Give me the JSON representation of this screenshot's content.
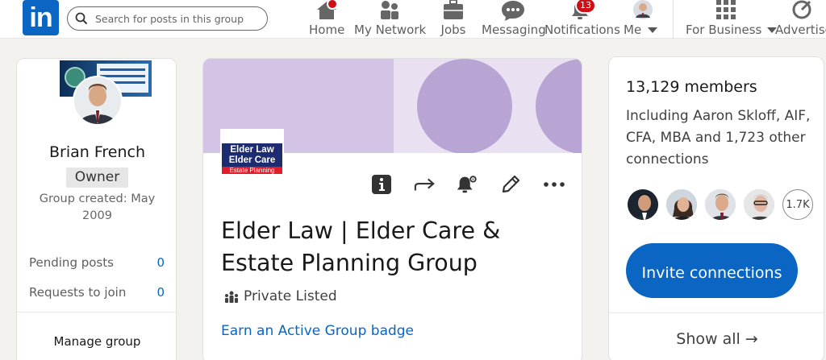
{
  "nav": {
    "logo_text": "in",
    "search_placeholder": "Search for posts in this group",
    "items": [
      {
        "label": "Home"
      },
      {
        "label": "My Network"
      },
      {
        "label": "Jobs"
      },
      {
        "label": "Messaging"
      },
      {
        "label": "Notifications",
        "badge": "13"
      },
      {
        "label": "Me"
      },
      {
        "label": "For Business"
      },
      {
        "label": "Advertise"
      }
    ]
  },
  "left": {
    "owner_name": "Brian French",
    "owner_role": "Owner",
    "created": "Group created: May 2009",
    "stats": [
      {
        "label": "Pending posts",
        "value": "0"
      },
      {
        "label": "Requests to join",
        "value": "0"
      }
    ],
    "manage_label": "Manage group"
  },
  "center": {
    "logo_line1": "Elder Law",
    "logo_line2": "Elder Care",
    "logo_line3": "Estate Planning",
    "title": "Elder Law | Elder Care & Estate Planning Group",
    "privacy": "Private Listed",
    "badge_link": "Earn an Active Group badge"
  },
  "right": {
    "members": "13,129 members",
    "including": "Including Aaron Skloff, AIF, CFA, MBA and 1,723 other connections",
    "more_count": "1.7K",
    "invite_label": "Invite connections",
    "show_all": "Show all →"
  },
  "colors": {
    "brand": "#0a66c2",
    "banner_left": "#d3c3e5",
    "banner_right": "#e9e0f2",
    "banner_circle": "#b9a5d4",
    "notification_badge": "#cc1016"
  }
}
